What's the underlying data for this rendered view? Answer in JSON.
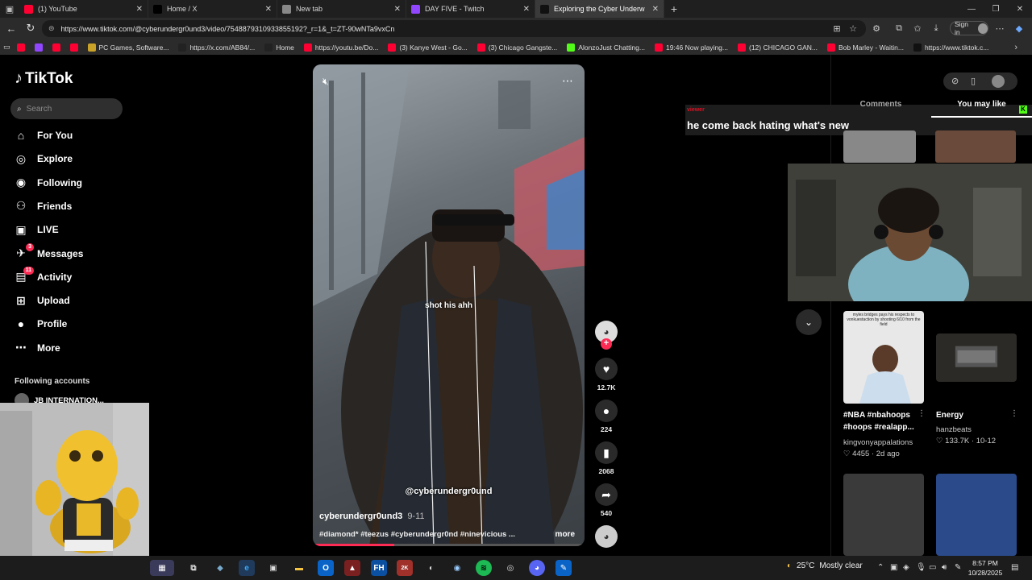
{
  "browser": {
    "tabs": [
      {
        "title": "(1) YouTube",
        "icon": "youtube-icon",
        "color": "#ff0033",
        "active": false
      },
      {
        "title": "Home / X",
        "icon": "x-icon",
        "color": "#000000",
        "active": false
      },
      {
        "title": "New tab",
        "icon": "newtab-icon",
        "color": "#888888",
        "active": false
      },
      {
        "title": "DAY FIVE - Twitch",
        "icon": "twitch-icon",
        "color": "#9146ff",
        "active": false
      },
      {
        "title": "Exploring the Cyber Underw",
        "icon": "tiktok-icon",
        "color": "#111111",
        "active": true
      }
    ],
    "url": "https://www.tiktok.com/@cyberundergr0und3/video/7548879310933855192?_r=1&_t=ZT-90wNTa9vxCn",
    "signin_label": "Sign in",
    "bookmarks": [
      {
        "label": "",
        "color": "#ff0033"
      },
      {
        "label": "",
        "color": "#9146ff"
      },
      {
        "label": "",
        "color": "#ff0033"
      },
      {
        "label": "",
        "color": "#ff0033"
      },
      {
        "label": "PC Games, Software...",
        "color": "#c9a227"
      },
      {
        "label": "https://x.com/AB84/...",
        "color": "#222222"
      },
      {
        "label": "Home",
        "color": "#222222"
      },
      {
        "label": "https://youtu.be/Do...",
        "color": "#ff0033"
      },
      {
        "label": "(3) Kanye West - Go...",
        "color": "#ff0033"
      },
      {
        "label": "(3) Chicago Gangste...",
        "color": "#ff0033"
      },
      {
        "label": "AlonzoJust Chatting...",
        "color": "#53fc18"
      },
      {
        "label": "19:46 Now playing...",
        "color": "#ff0033"
      },
      {
        "label": "(12) CHICAGO GAN...",
        "color": "#ff0033"
      },
      {
        "label": "Bob Marley - Waitin...",
        "color": "#ff0033"
      },
      {
        "label": "https://www.tiktok.c...",
        "color": "#111111"
      }
    ]
  },
  "sidebar": {
    "logo": "TikTok",
    "search_placeholder": "Search",
    "nav": [
      {
        "label": "For You",
        "icon": "home-icon",
        "glyph": "⌂",
        "badge": ""
      },
      {
        "label": "Explore",
        "icon": "compass-icon",
        "glyph": "◎",
        "badge": ""
      },
      {
        "label": "Following",
        "icon": "following-icon",
        "glyph": "◉",
        "badge": ""
      },
      {
        "label": "Friends",
        "icon": "friends-icon",
        "glyph": "⚇",
        "badge": ""
      },
      {
        "label": "LIVE",
        "icon": "live-icon",
        "glyph": "▣",
        "badge": ""
      },
      {
        "label": "Messages",
        "icon": "messages-icon",
        "glyph": "✈",
        "badge": "3"
      },
      {
        "label": "Activity",
        "icon": "activity-icon",
        "glyph": "▤",
        "badge": "11"
      },
      {
        "label": "Upload",
        "icon": "upload-icon",
        "glyph": "⊞",
        "badge": ""
      },
      {
        "label": "Profile",
        "icon": "profile-icon",
        "glyph": "●",
        "badge": ""
      },
      {
        "label": "More",
        "icon": "more-icon",
        "glyph": "⋯",
        "badge": ""
      }
    ],
    "following_title": "Following accounts",
    "following_account": "JB INTERNATION..."
  },
  "video": {
    "caption_overlay": "shot his ahh",
    "watermark": "@cyberundergr0und",
    "author": "cyberundergr0und3",
    "date": "9-11",
    "tags": "#diamond* #teezus #cyberundergr0nd #ninevicious ...",
    "more_label": "more",
    "progress": 0.3
  },
  "actions": {
    "likes": "12.7K",
    "comments": "224",
    "saves": "2068",
    "shares": "540"
  },
  "panel": {
    "tabs": [
      "Comments",
      "You may like"
    ],
    "selected_tab": "You may like",
    "chat_line": "he come back hating what's new",
    "chat_name": "viewer",
    "cards": [
      {
        "title": "#NBA #nbahoops #hoops #realapp...",
        "user": "kingvonyappalations",
        "stats": "♡ 4455 · 2d ago",
        "thumb_text": "myles bridges pays his respects to vonkuestaction by shooting 6/10 from the field"
      },
      {
        "title": "Energy",
        "user": "hanzbeats",
        "stats": "♡ 133.7K · 10-12",
        "thumb_text": ""
      }
    ]
  },
  "taskbar": {
    "weather_temp": "25°C",
    "weather_desc": "Mostly clear",
    "time": "8:57 PM",
    "date": "10/28/2025"
  }
}
